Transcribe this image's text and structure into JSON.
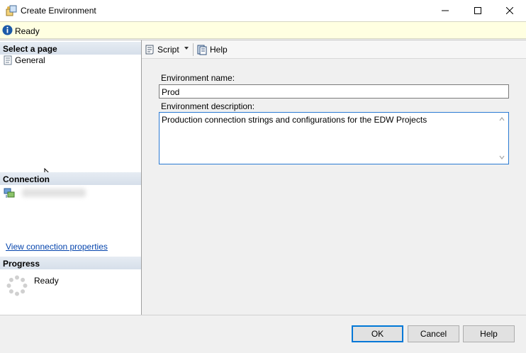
{
  "window": {
    "title": "Create Environment",
    "title_icon": "create-environment-icon"
  },
  "status": {
    "text": "Ready",
    "icon": "info-icon"
  },
  "left_pane": {
    "select_page_header": "Select a page",
    "pages": [
      {
        "label": "General",
        "icon": "page-icon"
      }
    ],
    "connection_header": "Connection",
    "connection_icon": "server-connection-icon",
    "view_connection_link": "View connection properties",
    "progress_header": "Progress",
    "progress_status": "Ready"
  },
  "toolbar": {
    "script_label": "Script",
    "help_label": "Help"
  },
  "form": {
    "env_name_label": "Environment name:",
    "env_name_value": "Prod",
    "env_desc_label": "Environment description:",
    "env_desc_value": "Production connection strings and configurations for the EDW Projects"
  },
  "buttons": {
    "ok": "OK",
    "cancel": "Cancel",
    "help": "Help"
  },
  "colors": {
    "status_bg": "#ffffe1",
    "ok_focus_border": "#0078d7",
    "link": "#0645ad",
    "section_header": "#dde5ef"
  }
}
